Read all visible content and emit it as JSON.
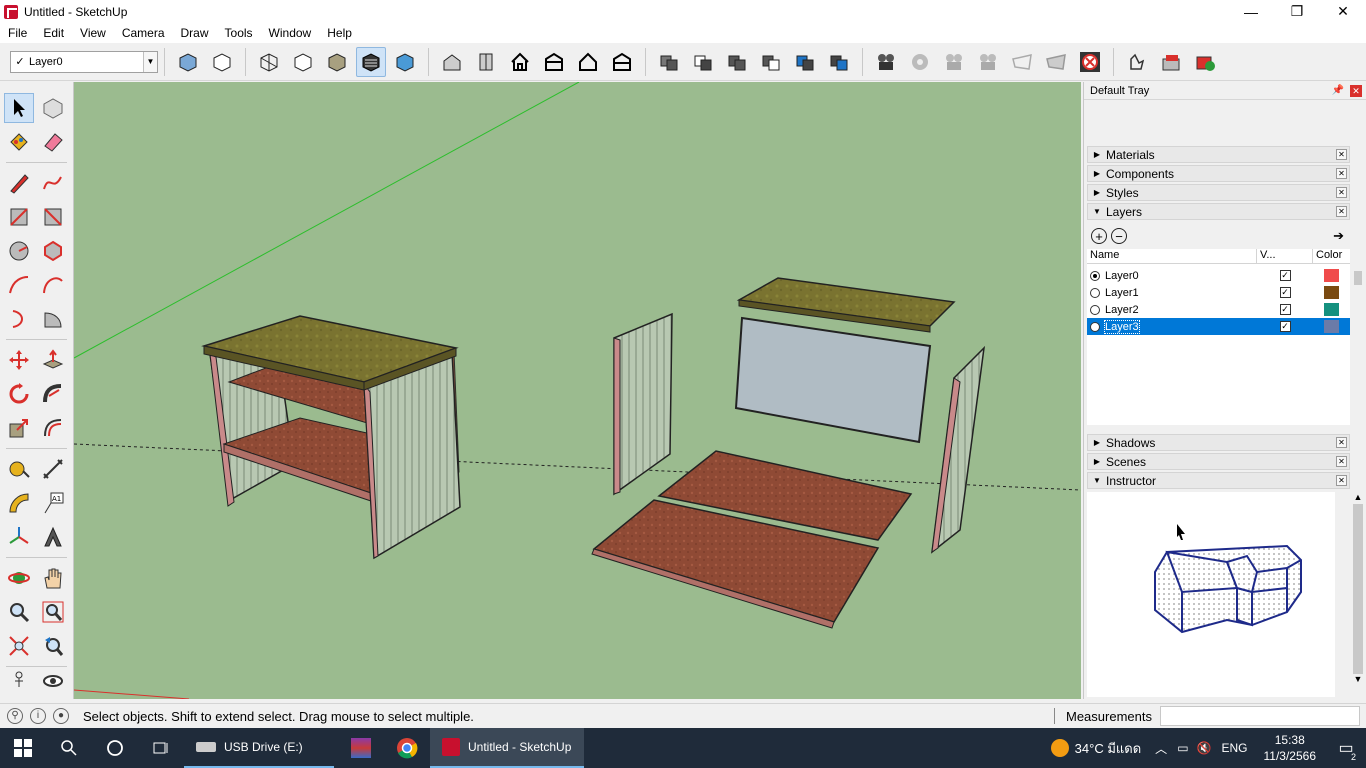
{
  "window": {
    "title": "Untitled - SketchUp",
    "controls": [
      "—",
      "❐",
      "✕"
    ]
  },
  "menu": [
    "File",
    "Edit",
    "View",
    "Camera",
    "Draw",
    "Tools",
    "Window",
    "Help"
  ],
  "toolbar": {
    "layer_selector": {
      "check": "✓",
      "value": "Layer0"
    }
  },
  "tray": {
    "title": "Default Tray",
    "panels_top": [
      {
        "label": "Materials",
        "expanded": false
      },
      {
        "label": "Components",
        "expanded": false
      },
      {
        "label": "Styles",
        "expanded": false
      },
      {
        "label": "Layers",
        "expanded": true
      }
    ],
    "layers": {
      "columns": {
        "name": "Name",
        "visible": "V...",
        "color": "Color"
      },
      "rows": [
        {
          "name": "Layer0",
          "active": true,
          "visible": true,
          "color": "#f04b4b",
          "selected": false
        },
        {
          "name": "Layer1",
          "active": false,
          "visible": true,
          "color": "#7a4a10",
          "selected": false
        },
        {
          "name": "Layer2",
          "active": false,
          "visible": true,
          "color": "#15917f",
          "selected": false
        },
        {
          "name": "Layer3",
          "active": false,
          "visible": true,
          "color": "#6b7ba8",
          "selected": true
        }
      ]
    },
    "panels_bottom": [
      {
        "label": "Shadows",
        "expanded": false
      },
      {
        "label": "Scenes",
        "expanded": false
      },
      {
        "label": "Instructor",
        "expanded": true
      }
    ]
  },
  "status": {
    "message": "Select objects. Shift to extend select. Drag mouse to select multiple.",
    "measurements_label": "Measurements",
    "measurements_value": ""
  },
  "taskbar": {
    "apps": [
      {
        "label": "USB Drive (E:)",
        "icon": "drive-icon"
      },
      {
        "label": "",
        "icon": "winrar-icon"
      },
      {
        "label": "",
        "icon": "chrome-icon"
      },
      {
        "label": "Untitled - SketchUp",
        "icon": "sketchup-icon"
      }
    ],
    "weather": "34°C มีแดด",
    "language": "ENG",
    "time": "15:38",
    "date": "11/3/2566",
    "notifications": "2"
  }
}
